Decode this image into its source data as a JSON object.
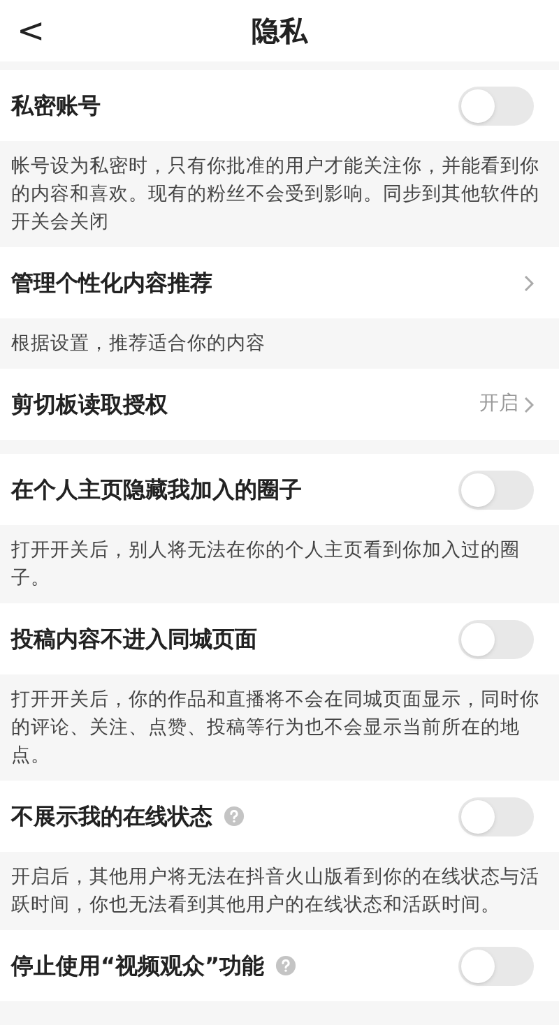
{
  "header": {
    "back": "<",
    "title": "隐私"
  },
  "sections": [
    {
      "items": [
        {
          "kind": "toggle",
          "label": "私密账号",
          "on": false,
          "description": "帐号设为私密时，只有你批准的用户才能关注你，并能看到你的内容和喜欢。现有的粉丝不会受到影响。同步到其他软件的开关会关闭"
        },
        {
          "kind": "link",
          "label": "管理个性化内容推荐",
          "description": "根据设置，推荐适合你的内容"
        },
        {
          "kind": "link",
          "label": "剪切板读取授权",
          "value": "开启"
        }
      ]
    },
    {
      "items": [
        {
          "kind": "toggle",
          "label": "在个人主页隐藏我加入的圈子",
          "on": false,
          "description": "打开开关后，别人将无法在你的个人主页看到你加入过的圈子。"
        },
        {
          "kind": "toggle",
          "label": "投稿内容不进入同城页面",
          "on": false,
          "description": "打开开关后，你的作品和直播将不会在同城页面显示，同时你的评论、关注、点赞、投稿等行为也不会显示当前所在的地点。"
        },
        {
          "kind": "toggle",
          "label": "不展示我的在线状态",
          "on": false,
          "help": true,
          "description": "开启后，其他用户将无法在抖音火山版看到你的在线状态与活跃时间，你也无法看到其他用户的在线状态和活跃时间。"
        },
        {
          "kind": "toggle",
          "label": "停止使用“视频观众”功能",
          "on": false,
          "help": true
        }
      ]
    }
  ]
}
